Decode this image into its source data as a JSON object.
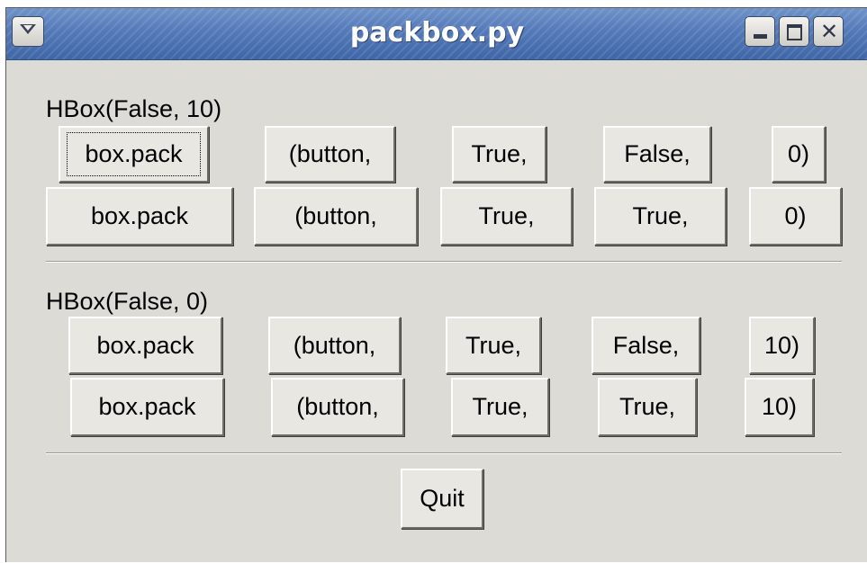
{
  "window": {
    "title": "packbox.py",
    "menu_icon": "chevron-down-icon",
    "minimize_icon": "minimize-icon",
    "maximize_icon": "maximize-icon",
    "close_icon": "close-icon",
    "close_glyph": "✕"
  },
  "section1": {
    "label": "HBox(False, 10)",
    "row1": [
      "box.pack",
      "(button,",
      "True,",
      "False,",
      "0)"
    ],
    "row2": [
      "box.pack",
      "(button,",
      "True,",
      "True,",
      "0)"
    ]
  },
  "section2": {
    "label": "HBox(False, 0)",
    "row1": [
      "box.pack",
      "(button,",
      "True,",
      "False,",
      "10)"
    ],
    "row2": [
      "box.pack",
      "(button,",
      "True,",
      "True,",
      "10)"
    ]
  },
  "quit_label": "Quit",
  "colors": {
    "window_bg": "#dddbd5",
    "titlebar": "#5479b8",
    "title_text": "#ffffff"
  }
}
